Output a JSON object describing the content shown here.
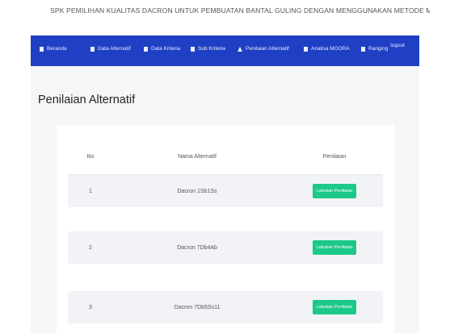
{
  "app": {
    "title": "SPK PEMILIHAN KUALITAS DACRON UNTUK PEMBUATAN BANTAL GULING DENGAN MENGGUNAKAN METODE MOORA"
  },
  "nav": {
    "items": [
      {
        "label": "Beranda",
        "icon": "home-icon"
      },
      {
        "label": "Data Alternatif",
        "icon": "data-icon"
      },
      {
        "label": "Data Kriteria",
        "icon": "data-icon"
      },
      {
        "label": "Sub Kriteria",
        "icon": "data-icon"
      },
      {
        "label": "Penilaian Alternatif",
        "icon": "assessment-icon"
      },
      {
        "label": "Analisa MOORA",
        "icon": "data-icon"
      },
      {
        "label": "Ranging",
        "icon": "data-icon"
      }
    ],
    "logout": "logout"
  },
  "page": {
    "title": "Penilaian Alternatif"
  },
  "table": {
    "headers": [
      "No",
      "Nama Alternatif",
      "Penilaian"
    ],
    "rows": [
      {
        "no": "1",
        "name": "Dacron 1Sb1Ss",
        "action": "Lakukan Penilaian"
      },
      {
        "no": "2",
        "name": "Dacron 7Db4Ab",
        "action": "Lakukan Penilaian"
      },
      {
        "no": "3",
        "name": "Dacron 7Db5Ss11",
        "action": "Lakukan Penilaian"
      }
    ]
  },
  "colors": {
    "navbar": "#1f3fc4",
    "button": "#1cc88a",
    "content_bg": "#f5f6f8"
  }
}
